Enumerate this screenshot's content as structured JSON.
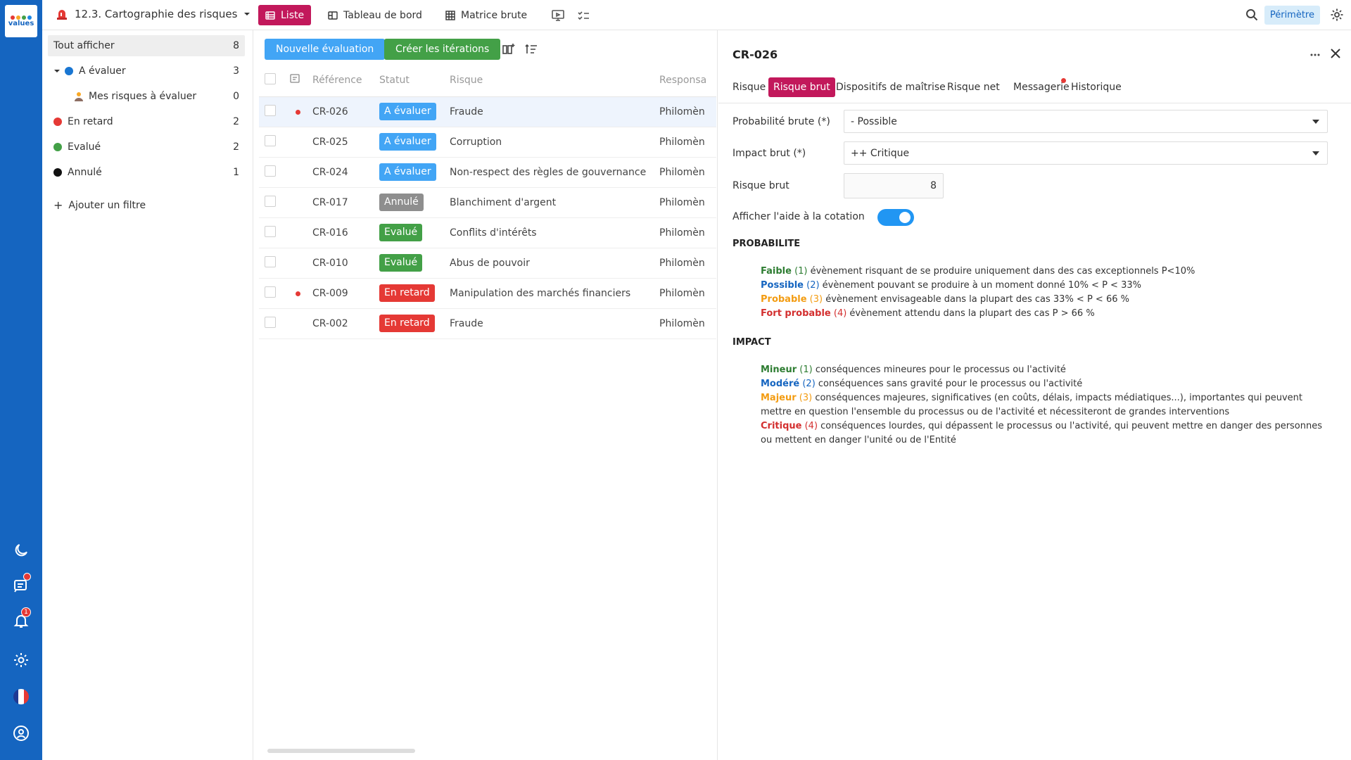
{
  "app": {
    "logo_text": "values",
    "module_title": "12.3. Cartographie des risques",
    "perimetre_label": "Périmètre",
    "rail_badge_count": "1"
  },
  "views": {
    "liste": "Liste",
    "tableau": "Tableau de bord",
    "matrice": "Matrice brute"
  },
  "filters": {
    "items": [
      {
        "label": "Tout afficher",
        "count": "8"
      },
      {
        "label": "A évaluer",
        "count": "3",
        "color": "#1976d2"
      },
      {
        "label": "Mes risques à évaluer",
        "count": "0"
      },
      {
        "label": "En retard",
        "count": "2",
        "color": "#e53935"
      },
      {
        "label": "Evalué",
        "count": "2",
        "color": "#43a047"
      },
      {
        "label": "Annulé",
        "count": "1",
        "color": "#111111"
      }
    ],
    "add_filter": "Ajouter un filtre"
  },
  "toolbar": {
    "new_eval": "Nouvelle évaluation",
    "create_iterations": "Créer les itérations"
  },
  "table": {
    "headers": {
      "ref": "Référence",
      "status": "Statut",
      "risk": "Risque",
      "resp": "Responsa"
    },
    "rows": [
      {
        "ref": "CR-026",
        "status": "A évaluer",
        "status_color": "#42a5f5",
        "risk": "Fraude",
        "resp": "Philomèn",
        "dot": true
      },
      {
        "ref": "CR-025",
        "status": "A évaluer",
        "status_color": "#42a5f5",
        "risk": "Corruption",
        "resp": "Philomèn",
        "dot": false
      },
      {
        "ref": "CR-024",
        "status": "A évaluer",
        "status_color": "#42a5f5",
        "risk": "Non-respect des règles de gouvernance",
        "resp": "Philomèn",
        "dot": false
      },
      {
        "ref": "CR-017",
        "status": "Annulé",
        "status_color": "#8e8e8e",
        "risk": "Blanchiment d'argent",
        "resp": "Philomèn",
        "dot": false
      },
      {
        "ref": "CR-016",
        "status": "Evalué",
        "status_color": "#43a047",
        "risk": "Conflits d'intérêts",
        "resp": "Philomèn",
        "dot": false
      },
      {
        "ref": "CR-010",
        "status": "Evalué",
        "status_color": "#43a047",
        "risk": "Abus de pouvoir",
        "resp": "Philomèn",
        "dot": false
      },
      {
        "ref": "CR-009",
        "status": "En retard",
        "status_color": "#e53935",
        "risk": "Manipulation des marchés financiers",
        "resp": "Philomèn",
        "dot": true
      },
      {
        "ref": "CR-002",
        "status": "En retard",
        "status_color": "#e53935",
        "risk": "Fraude",
        "resp": "Philomèn",
        "dot": false
      }
    ]
  },
  "detail": {
    "title": "CR-026",
    "tabs": [
      "Risque",
      "Risque brut",
      "Dispositifs de maîtrise",
      "Risque net",
      "Messagerie",
      "Historique"
    ],
    "fields": {
      "prob_label": "Probabilité brute (*)",
      "prob_value": "- Possible",
      "impact_label": "Impact brut (*)",
      "impact_value": "++ Critique",
      "risk_label": "Risque brut",
      "risk_value": "8",
      "toggle_label": "Afficher l'aide à la cotation"
    },
    "probabilite": {
      "title": "PROBABILITE",
      "items": [
        {
          "kw": "Faible",
          "lvl": " (1)",
          "text": " évènement risquant de se produire uniquement dans des cas exceptionnels P<10%",
          "color": "#2e7d32"
        },
        {
          "kw": "Possible",
          "lvl": " (2)",
          "text": " évènement pouvant se produire à un moment donné 10% < P < 33%",
          "color": "#1565c0"
        },
        {
          "kw": "Probable",
          "lvl": " (3)",
          "text": " évènement envisageable dans la plupart des cas 33% < P < 66 %",
          "color": "#f39c12"
        },
        {
          "kw": "Fort probable",
          "lvl": " (4)",
          "text": " évènement attendu dans la plupart des cas P > 66 %",
          "color": "#d32f2f"
        }
      ]
    },
    "impact": {
      "title": "IMPACT",
      "items": [
        {
          "kw": "Mineur",
          "lvl": " (1)",
          "text": " conséquences mineures pour le processus ou l'activité",
          "color": "#2e7d32"
        },
        {
          "kw": "Modéré",
          "lvl": " (2)",
          "text": " conséquences sans gravité pour le processus ou l'activité",
          "color": "#1565c0"
        },
        {
          "kw": "Majeur",
          "lvl": " (3)",
          "text": " conséquences majeures, significatives (en coûts, délais, impacts médiatiques...), importantes qui peuvent mettre en question l'ensemble du processus ou de l'activité et nécessiteront de grandes interventions",
          "color": "#f39c12"
        },
        {
          "kw": "Critique",
          "lvl": " (4)",
          "text": " conséquences lourdes, qui dépassent le processus ou l'activité, qui peuvent mettre en danger des personnes ou mettent en danger l'unité ou de l'Entité",
          "color": "#d32f2f"
        }
      ]
    }
  },
  "colors": {
    "rail": "#1565c0",
    "accent": "#c2185b",
    "blue_btn": "#42a5f5",
    "green_btn": "#43a047"
  }
}
